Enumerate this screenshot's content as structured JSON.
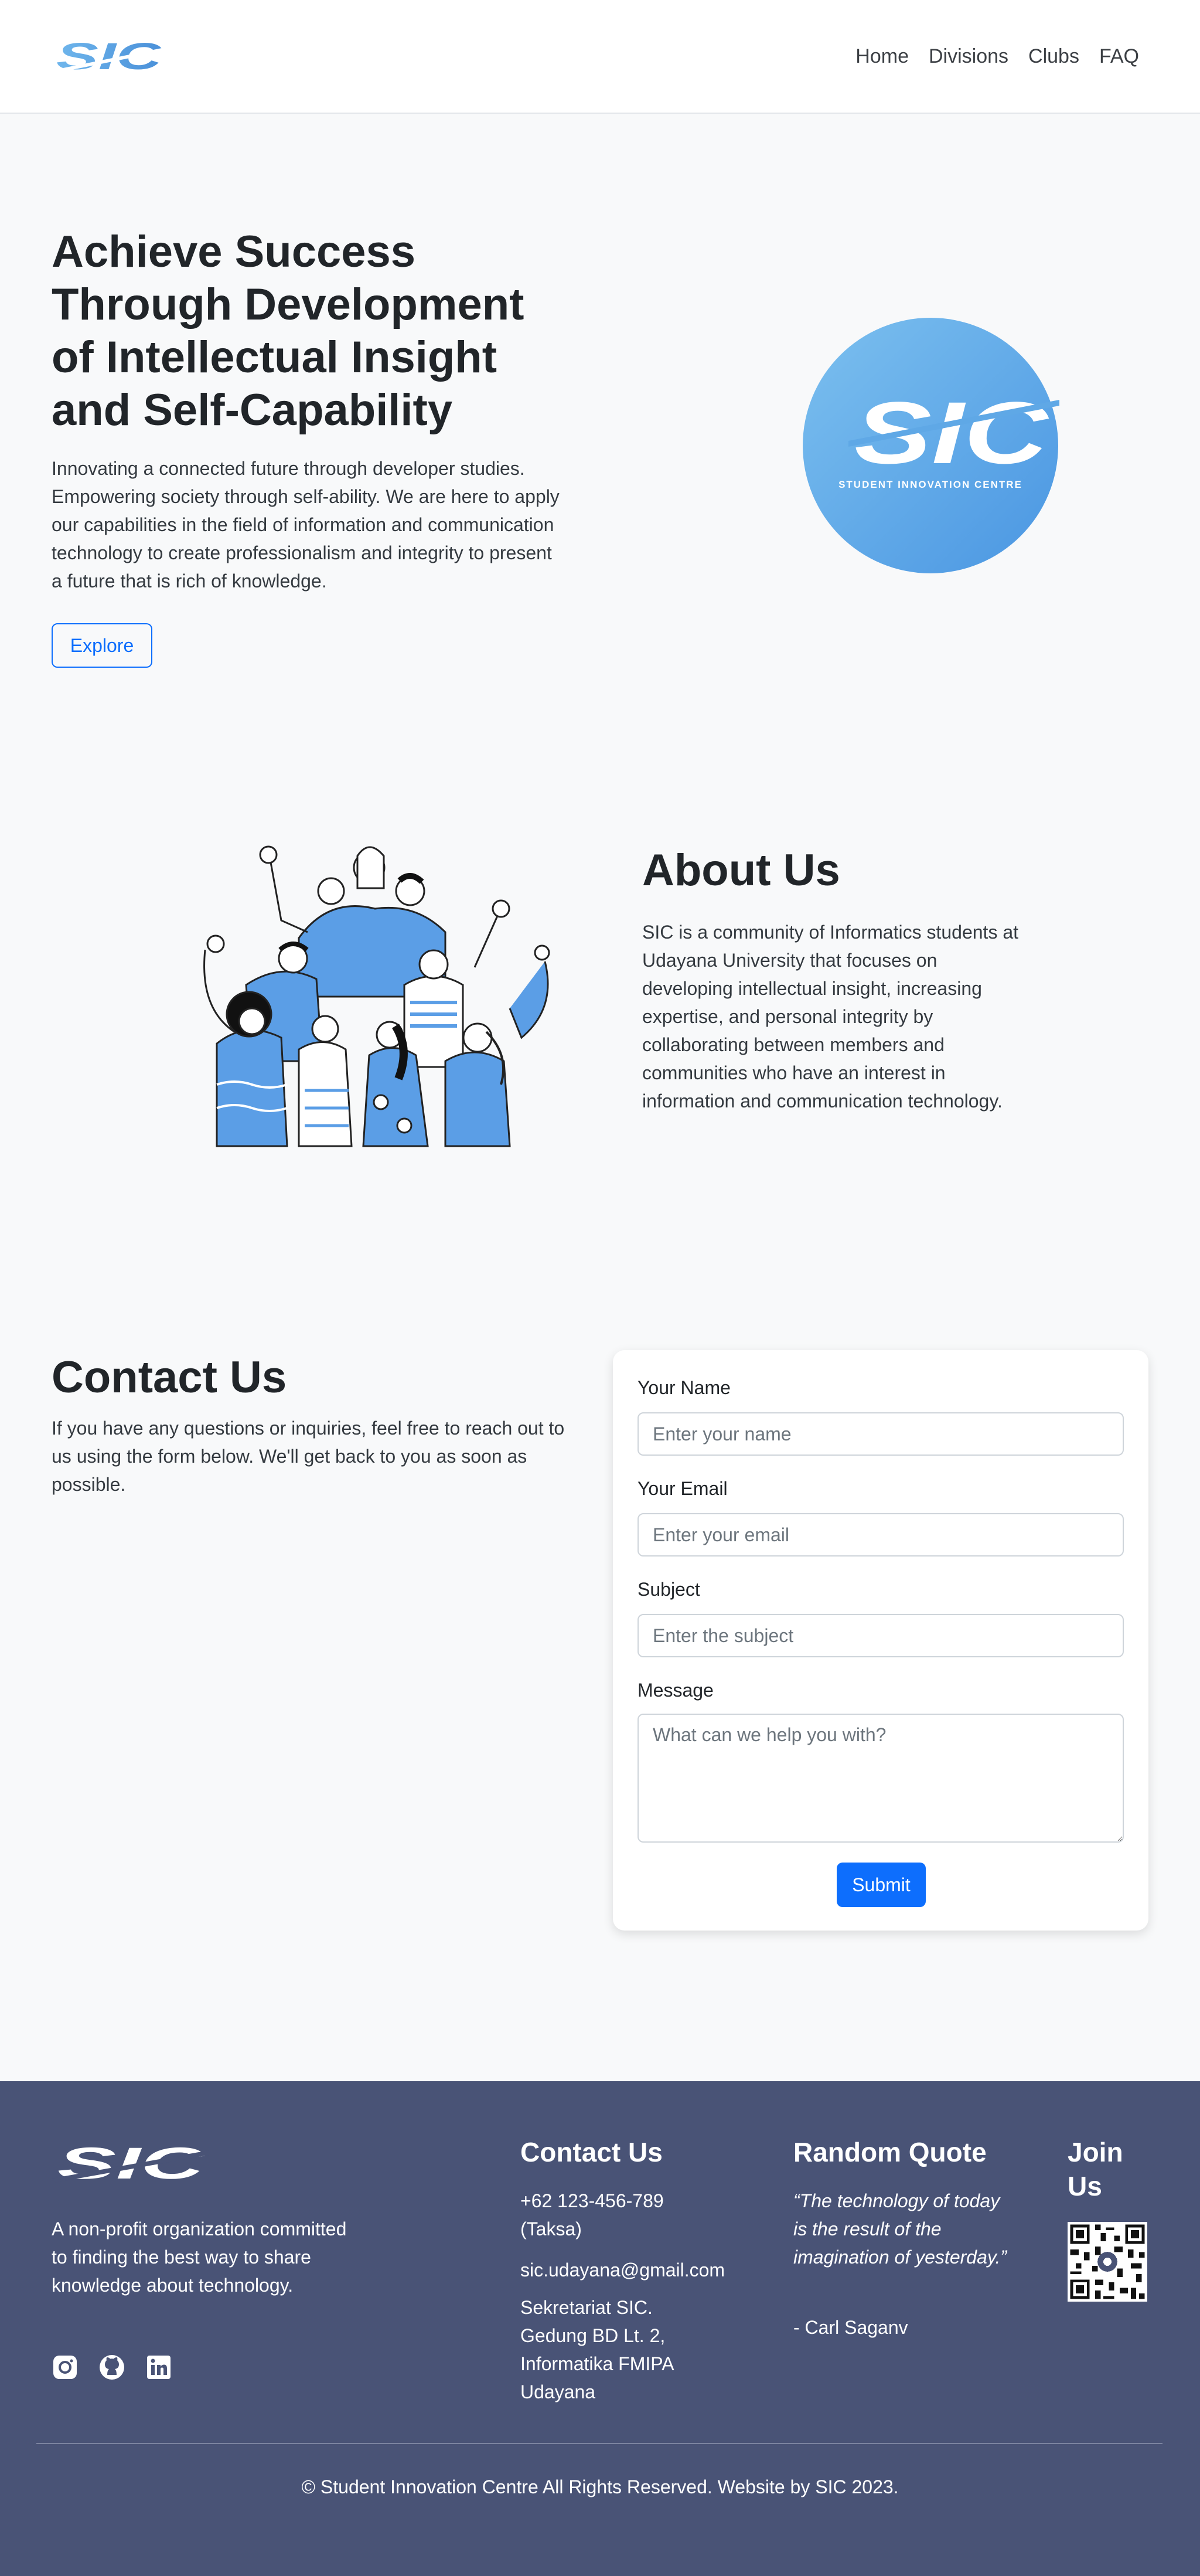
{
  "nav": {
    "logo_text": "SIC",
    "links": [
      "Home",
      "Divisions",
      "Clubs",
      "FAQ"
    ]
  },
  "hero": {
    "title": "Achieve Success Through Development of Intellectual Insight and Self-Capability",
    "text": "Innovating a connected future through developer studies. Empowering society through self-ability. We are here to apply our capabilities in the field of information and communication technology to create professionalism and integrity to present a future that is rich of knowledge.",
    "explore_label": "Explore",
    "logo_text": "SIC",
    "logo_subtitle": "STUDENT INNOVATION CENTRE"
  },
  "about": {
    "title": "About Us",
    "text": "SIC is a community of Informatics students at Udayana University that focuses on developing intellectual insight, increasing expertise, and personal integrity by collaborating between members and communities who have an interest in information and communication technology."
  },
  "contact": {
    "title": "Contact Us",
    "text": "If you have any questions or inquiries, feel free to reach out to us using the form below. We'll get back to you as soon as possible.",
    "form": {
      "name_label": "Your Name",
      "name_placeholder": "Enter your name",
      "email_label": "Your Email",
      "email_placeholder": "Enter your email",
      "subject_label": "Subject",
      "subject_placeholder": "Enter the subject",
      "message_label": "Message",
      "message_placeholder": "What can we help you with?",
      "submit_label": "Submit"
    }
  },
  "footer": {
    "logo_text": "SIC",
    "description": "A non-profit organization committed to finding the best way to share knowledge about technology.",
    "socials": [
      "instagram-icon",
      "github-icon",
      "linkedin-icon"
    ],
    "contact_title": "Contact Us",
    "phone": "+62 123-456-789 (Taksa)",
    "email": "sic.udayana@gmail.com",
    "address": "Sekretariat SIC. Gedung BD Lt. 2, Informatika FMIPA Udayana",
    "quote_title": "Random Quote",
    "quote": "“The technology of today is the result of the imagination of yesterday.”",
    "quote_author": "- Carl Saganv",
    "join_title": "Join Us",
    "copyright": "© Student Innovation Centre All Rights Reserved. Website by SIC 2023."
  },
  "colors": {
    "brand_blue": "#5ba4e6",
    "primary": "#0d6efd",
    "footer_bg": "#495376"
  }
}
